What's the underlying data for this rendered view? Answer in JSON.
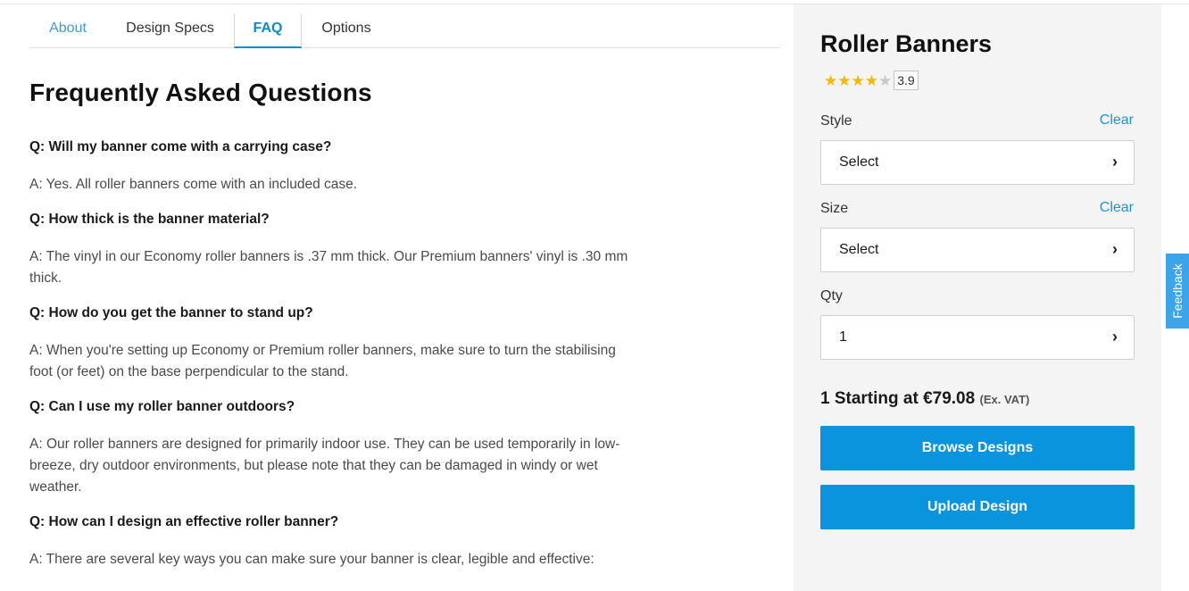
{
  "tabs": [
    "About",
    "Design Specs",
    "FAQ",
    "Options"
  ],
  "faq": {
    "title": "Frequently Asked Questions",
    "items": [
      {
        "q": "Q: Will my banner come with a carrying case?",
        "a": "A: Yes. All roller banners come with an included case."
      },
      {
        "q": "Q: How thick is the banner material?",
        "a": "A: The vinyl in our Economy roller banners is .37 mm thick. Our Premium banners' vinyl is .30 mm thick."
      },
      {
        "q": "Q: How do you get the banner to stand up?",
        "a": "A: When you're setting up Economy or Premium roller banners, make sure to turn the stabilising foot (or feet) on the base perpendicular to the stand."
      },
      {
        "q": "Q: Can I use my roller banner outdoors?",
        "a": "A: Our roller banners are designed for primarily indoor use. They can be used temporarily in low-breeze, dry outdoor environments, but please note that they can be damaged in windy or wet weather."
      },
      {
        "q": "Q: How can I design an effective roller banner?",
        "a": "A: There are several key ways you can make sure your banner is clear, legible and effective:"
      }
    ]
  },
  "product": {
    "title": "Roller Banners",
    "rating": {
      "value": 3.9,
      "label": "3.9",
      "max": 5
    },
    "style": {
      "label": "Style",
      "clear": "Clear",
      "value": "Select"
    },
    "size": {
      "label": "Size",
      "clear": "Clear",
      "value": "Select"
    },
    "qty": {
      "label": "Qty",
      "value": "1"
    },
    "price": {
      "main": "1 Starting at €79.08",
      "vat": "(Ex. VAT)"
    },
    "browse_label": "Browse Designs",
    "upload_label": "Upload Design"
  },
  "feedback_label": "Feedback",
  "colors": {
    "accent": "#0a94de",
    "link": "#1c95d6",
    "star": "#f5b800",
    "sidebar_bg": "#f4f4f4"
  }
}
